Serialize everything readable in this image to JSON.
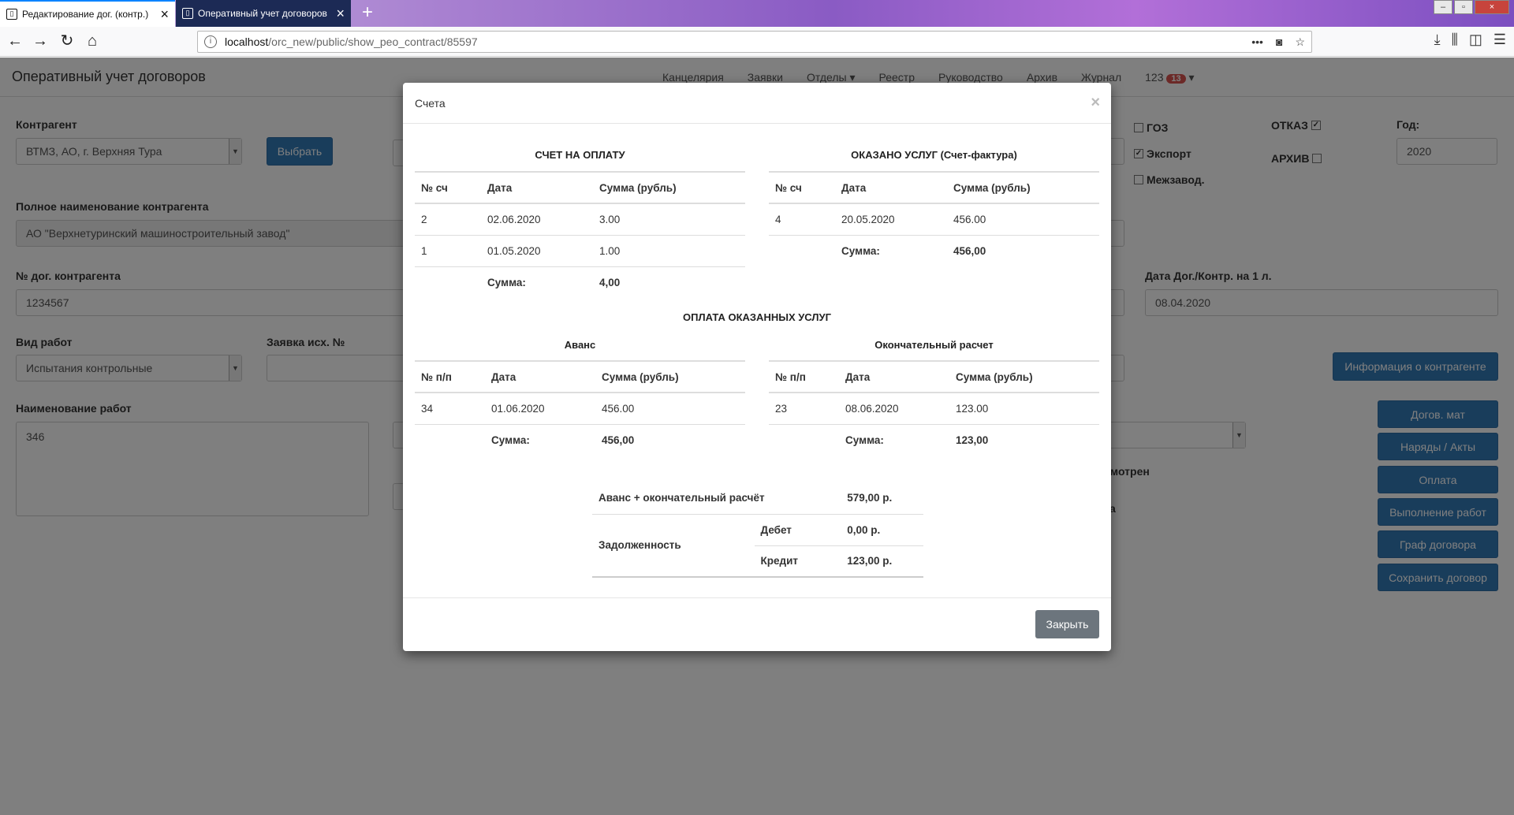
{
  "browser": {
    "tabs": [
      {
        "label": "Редактирование дог. (контр.)",
        "active": true
      },
      {
        "label": "Оперативный учет договоров",
        "active": false
      }
    ],
    "url_host": "localhost",
    "url_path": "/orc_new/public/show_peo_contract/85597"
  },
  "app": {
    "title": "Оперативный учет договоров",
    "menu": [
      "Канцелярия",
      "Заявки",
      "Отделы ▾",
      "Реестр",
      "Руководство",
      "Архив",
      "Журнал"
    ],
    "user": "123",
    "user_badge": "13",
    "form": {
      "contragent_label": "Контрагент",
      "contragent_value": "ВТМЗ, АО, г. Верхняя Тура",
      "select_button": "Выбрать",
      "full_name_label": "Полное наименование контрагента",
      "full_name_value": "АО \"Верхнетуринский машиностроительный  завод\"",
      "contract_no_label": "№ дог. контрагента",
      "contract_no_value": "1234567",
      "work_type_label": "Вид работ",
      "work_type_value": "Испытания контрольные",
      "request_label": "Заявка исх. №",
      "work_name_label": "Наименование работ",
      "work_name_value": "346",
      "goz": "ГОЗ",
      "export": "Экспорт",
      "mezhzavod": "Межзавод.",
      "otkaz": "ОТКАЗ",
      "arhiv": "АРХИВ",
      "year_label": "Год:",
      "year_value": "2020",
      "date_label": "Дата Дог./Контр. на 1 л.",
      "date_value": "08.04.2020",
      "info_button": "Информация о контрагенте",
      "side_buttons": [
        "Догов. мат",
        "Наряды / Акты",
        "Оплата",
        "Выполнение работ",
        "Граф договора",
        "Сохранить договор"
      ],
      "partial_1": "смотрен",
      "partial_2": "ка"
    }
  },
  "modal": {
    "title": "Счета",
    "close_label": "Закрыть",
    "invoice": {
      "title": "СЧЕТ НА ОПЛАТУ",
      "headers": [
        "№ сч",
        "Дата",
        "Сумма (рубль)"
      ],
      "rows": [
        [
          "2",
          "02.06.2020",
          "3.00"
        ],
        [
          "1",
          "01.05.2020",
          "1.00"
        ]
      ],
      "sum_label": "Сумма:",
      "sum_value": "4,00"
    },
    "services": {
      "title": "ОКАЗАНО УСЛУГ (Счет-фактура)",
      "headers": [
        "№ сч",
        "Дата",
        "Сумма (рубль)"
      ],
      "rows": [
        [
          "4",
          "20.05.2020",
          "456.00"
        ]
      ],
      "sum_label": "Сумма:",
      "sum_value": "456,00"
    },
    "payment_title": "ОПЛАТА ОКАЗАННЫХ УСЛУГ",
    "advance": {
      "title": "Аванс",
      "headers": [
        "№ п/п",
        "Дата",
        "Сумма (рубль)"
      ],
      "rows": [
        [
          "34",
          "01.06.2020",
          "456.00"
        ]
      ],
      "sum_label": "Сумма:",
      "sum_value": "456,00"
    },
    "final": {
      "title": "Окончательный расчет",
      "headers": [
        "№ п/п",
        "Дата",
        "Сумма (рубль)"
      ],
      "rows": [
        [
          "23",
          "08.06.2020",
          "123.00"
        ]
      ],
      "sum_label": "Сумма:",
      "sum_value": "123,00"
    },
    "totals": {
      "total_label": "Аванс + окончательный расчёт",
      "total_value": "579,00 р.",
      "debt_label": "Задолженность",
      "debit_label": "Дебет",
      "debit_value": "0,00 р.",
      "credit_label": "Кредит",
      "credit_value": "123,00 р."
    }
  }
}
